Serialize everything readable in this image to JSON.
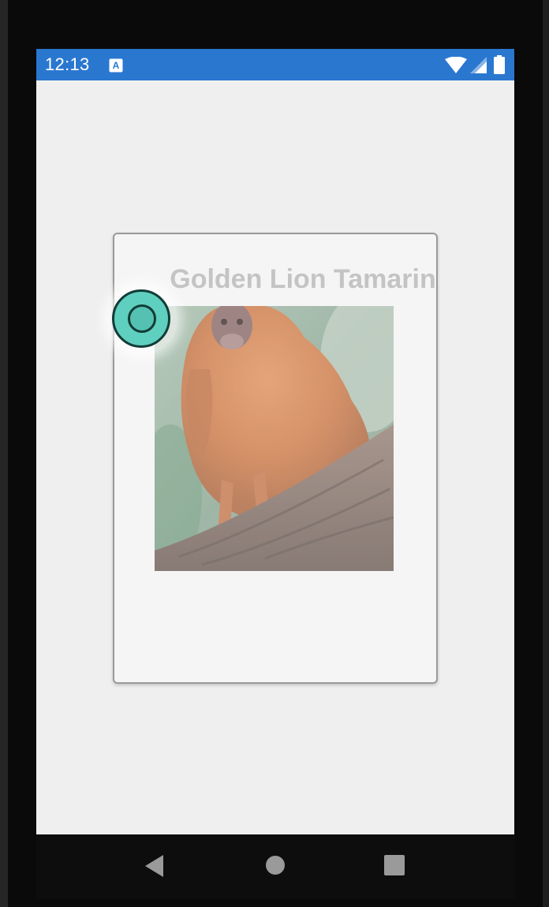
{
  "status_bar": {
    "time": "12:13",
    "notification_icon": "keyboard-a-icon",
    "wifi_icon": "wifi-icon",
    "signal_icon": "cell-signal-icon",
    "battery_icon": "battery-icon",
    "color": "#2a77d0"
  },
  "card": {
    "title": "Golden Lion Tamarin",
    "image_icon": "golden-lion-tamarin-photo"
  },
  "touch_indicator": {
    "color": "#5fcfbf"
  },
  "nav_bar": {
    "back_icon": "back-icon",
    "home_icon": "home-icon",
    "recents_icon": "recents-icon"
  }
}
